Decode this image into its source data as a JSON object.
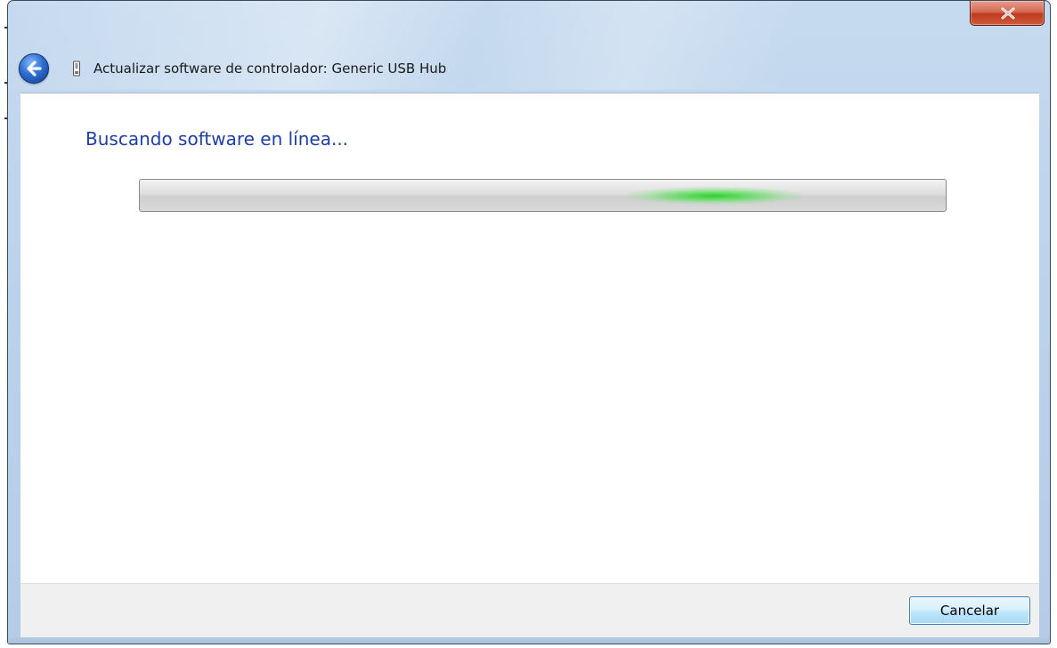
{
  "window": {
    "title": "Actualizar software de controlador: Generic USB Hub",
    "close_icon": "close-x-icon",
    "back_icon": "back-arrow-icon",
    "device_icon": "usb-device-icon"
  },
  "main": {
    "heading": "Buscando software en línea...",
    "progress": {
      "state": "indeterminate",
      "fill_color": "#22d222"
    }
  },
  "footer": {
    "cancel_label": "Cancelar"
  },
  "colors": {
    "heading": "#1c3fa8",
    "close_button": "#c0391f",
    "frame": "#bcd3ec"
  }
}
